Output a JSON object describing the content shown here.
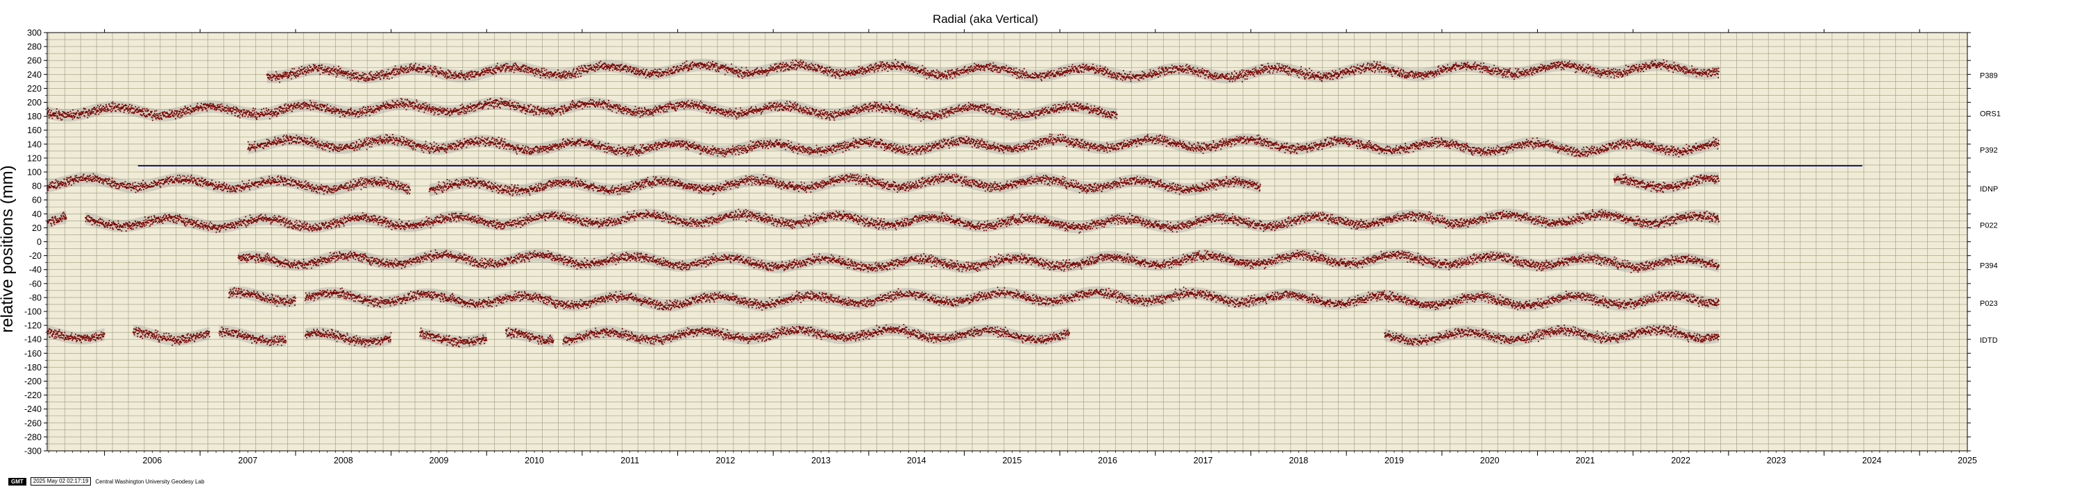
{
  "footer": {
    "logo": "GMT",
    "timestamp": "2025 May 02 02:17:19",
    "credit": "Central Washington University Geodesy Lab"
  },
  "colors": {
    "background": "#efebd6",
    "grid": "#9a9a7a",
    "points": "#7a0000",
    "envelope": "#9a9a9a",
    "reference_line": "#1a1a7a"
  },
  "chart_data": {
    "type": "scatter",
    "title": "Radial (aka Vertical)",
    "xlabel": "",
    "ylabel": "relative positions (mm)",
    "xlim": [
      2005.4,
      2025.5
    ],
    "ylim": [
      -300,
      300
    ],
    "x_ticks": [
      "2006",
      "2007",
      "2008",
      "2009",
      "2010",
      "2011",
      "2012",
      "2013",
      "2014",
      "2015",
      "2016",
      "2017",
      "2018",
      "2019",
      "2020",
      "2021",
      "2022",
      "2023",
      "2024",
      "2025"
    ],
    "y_ticks": [
      300,
      280,
      260,
      240,
      220,
      200,
      180,
      160,
      140,
      120,
      100,
      80,
      60,
      40,
      20,
      0,
      -20,
      -40,
      -60,
      -80,
      -100,
      -120,
      -140,
      -160,
      -180,
      -200,
      -220,
      -240,
      -260,
      -280,
      -300
    ],
    "grid": true,
    "reference_line": {
      "y": 109,
      "x": [
        2005.4,
        2024.4
      ]
    },
    "series": [
      {
        "name": "P389",
        "offset": 245,
        "segments": [
          [
            2007.7,
            2022.9
          ]
        ]
      },
      {
        "name": "ORS1",
        "offset": 190,
        "segments": [
          [
            2005.4,
            2016.6
          ]
        ]
      },
      {
        "name": "P392",
        "offset": 138,
        "segments": [
          [
            2007.5,
            2022.9
          ]
        ]
      },
      {
        "name": "IDNP",
        "offset": 82,
        "segments": [
          [
            2005.4,
            2009.2
          ],
          [
            2009.4,
            2018.1
          ],
          [
            2021.8,
            2022.9
          ]
        ]
      },
      {
        "name": "P022",
        "offset": 30,
        "segments": [
          [
            2005.4,
            2005.6
          ],
          [
            2005.8,
            2022.9
          ]
        ]
      },
      {
        "name": "P394",
        "offset": -28,
        "segments": [
          [
            2007.4,
            2022.9
          ]
        ]
      },
      {
        "name": "P023",
        "offset": -82,
        "segments": [
          [
            2007.3,
            2008.0
          ],
          [
            2008.1,
            2022.9
          ]
        ]
      },
      {
        "name": "IDTD",
        "offset": -135,
        "segments": [
          [
            2005.4,
            2006.0
          ],
          [
            2006.3,
            2007.1
          ],
          [
            2007.2,
            2007.9
          ],
          [
            2008.1,
            2009.0
          ],
          [
            2009.3,
            2010.0
          ],
          [
            2010.2,
            2010.7
          ],
          [
            2010.8,
            2016.1
          ],
          [
            2019.4,
            2022.9
          ]
        ]
      }
    ]
  }
}
